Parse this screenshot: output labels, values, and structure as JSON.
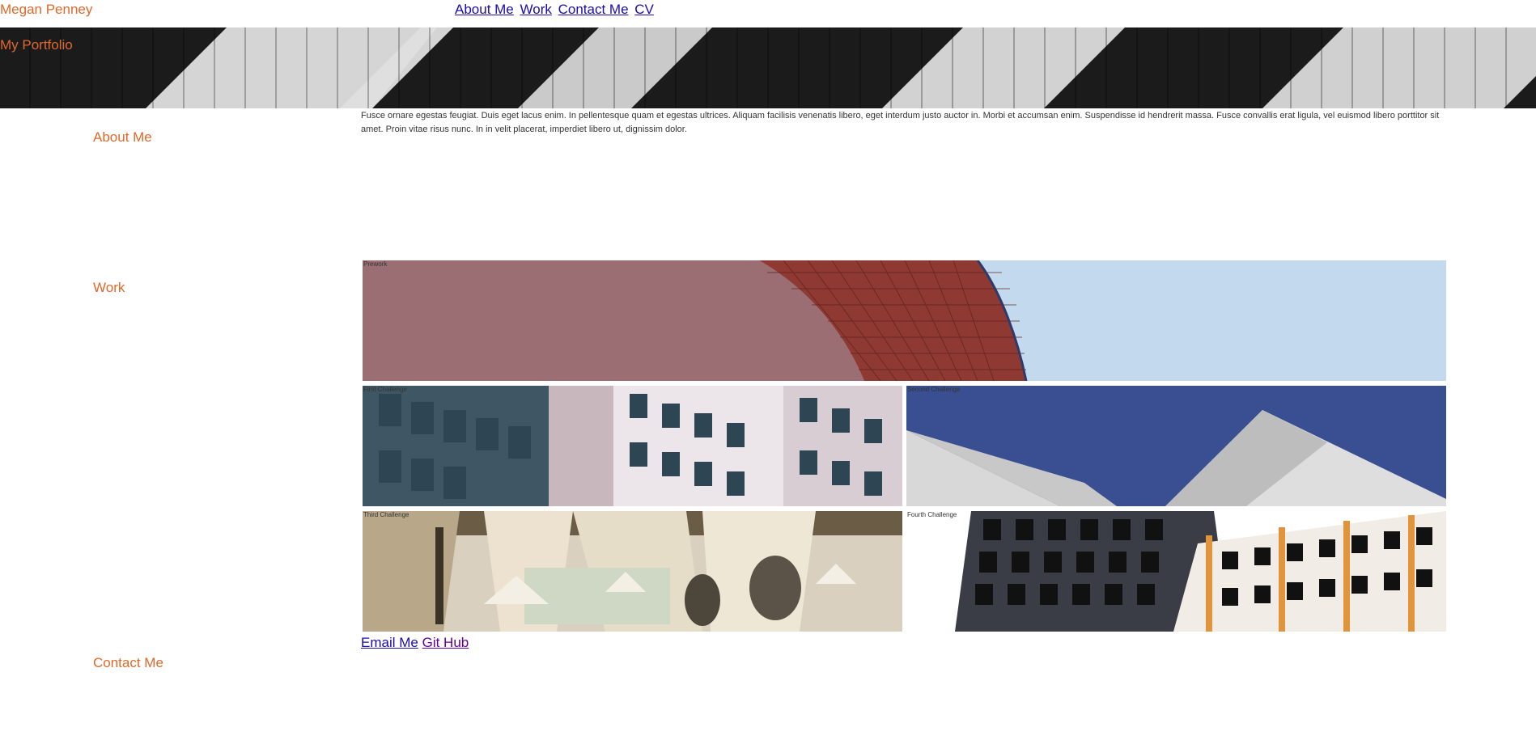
{
  "header": {
    "site_name": "Megan Penney",
    "nav": [
      {
        "label": "About Me"
      },
      {
        "label": "Work"
      },
      {
        "label": "Contact Me"
      },
      {
        "label": "CV"
      }
    ]
  },
  "hero": {
    "title": "My Portfolio"
  },
  "about": {
    "heading": "About Me",
    "text": "Fusce ornare egestas feugiat. Duis eget lacus enim. In pellentesque quam et egestas ultrices. Aliquam facilisis venenatis libero, eget interdum justo auctor in. Morbi et accumsan enim. Suspendisse id hendrerit massa. Fusce convallis erat ligula, vel euismod libero porttitor sit amet. Proin vitae risus nunc. In in velit placerat, imperdiet libero ut, dignissim dolor."
  },
  "work": {
    "heading": "Work",
    "tiles": [
      {
        "label": "Prework"
      },
      {
        "label": "First Challenge"
      },
      {
        "label": "Second Challenge"
      },
      {
        "label": "Third Challenge"
      },
      {
        "label": "Fourth Challenge"
      }
    ]
  },
  "contact": {
    "heading": "Contact Me",
    "links": [
      {
        "label": "Email Me"
      },
      {
        "label": "Git Hub"
      }
    ]
  },
  "colors": {
    "accent": "#e0682a",
    "link": "#1a0dab",
    "visited_link": "#660099"
  }
}
